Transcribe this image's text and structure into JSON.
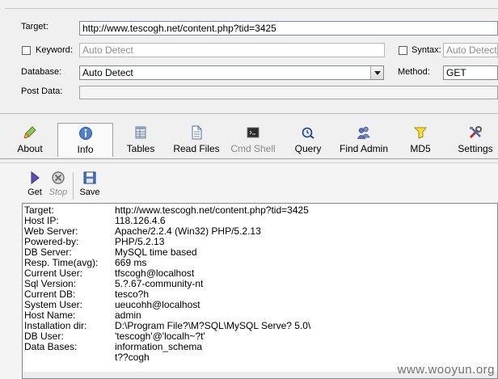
{
  "form": {
    "target_label": "Target:",
    "target_value": "http://www.tescogh.net/content.php?tid=3425",
    "keyword_label": "Keyword:",
    "keyword_placeholder": "Auto Detect",
    "syntax_label": "Syntax:",
    "syntax_placeholder": "Auto Detect",
    "database_label": "Database:",
    "database_value": "Auto Detect",
    "method_label": "Method:",
    "method_value": "GET",
    "postdata_label": "Post Data:"
  },
  "tabs": [
    {
      "label": "About",
      "icon": "brush-icon"
    },
    {
      "label": "Info",
      "icon": "info-icon"
    },
    {
      "label": "Tables",
      "icon": "table-icon"
    },
    {
      "label": "Read Files",
      "icon": "file-icon"
    },
    {
      "label": "Cmd Shell",
      "icon": "terminal-icon"
    },
    {
      "label": "Query",
      "icon": "query-icon"
    },
    {
      "label": "Find Admin",
      "icon": "users-icon"
    },
    {
      "label": "MD5",
      "icon": "key-icon"
    },
    {
      "label": "Settings",
      "icon": "tools-icon"
    }
  ],
  "active_tab": "Info",
  "toolbar": {
    "get_label": "Get",
    "stop_label": "Stop",
    "save_label": "Save"
  },
  "info": [
    {
      "key": "Target:",
      "value": "http://www.tescogh.net/content.php?tid=3425"
    },
    {
      "key": "Host IP:",
      "value": "118.126.4.6"
    },
    {
      "key": "Web Server:",
      "value": "Apache/2.2.4 (Win32) PHP/5.2.13"
    },
    {
      "key": "Powered-by:",
      "value": "PHP/5.2.13"
    },
    {
      "key": "DB Server:",
      "value": "MySQL time based"
    },
    {
      "key": "Resp. Time(avg):",
      "value": "669 ms"
    },
    {
      "key": "Current User:",
      "value": "tfscogh@localhost"
    },
    {
      "key": "Sql Version:",
      "value": "5.?.67-community-nt"
    },
    {
      "key": "Current DB:",
      "value": "tesco?h"
    },
    {
      "key": "System User:",
      "value": "ueucohh@localhost"
    },
    {
      "key": "Host Name:",
      "value": "admin"
    },
    {
      "key": "Installation dir:",
      "value": "D:\\Program File?\\M?SQL\\MySQL Serve? 5.0\\"
    },
    {
      "key": "DB User:",
      "value": "'tescogh'@'localh~?t'"
    },
    {
      "key": "Data Bases:",
      "value": "information_schema"
    },
    {
      "key": "",
      "value": "t??cogh"
    }
  ],
  "watermark": "www.wooyun.org"
}
